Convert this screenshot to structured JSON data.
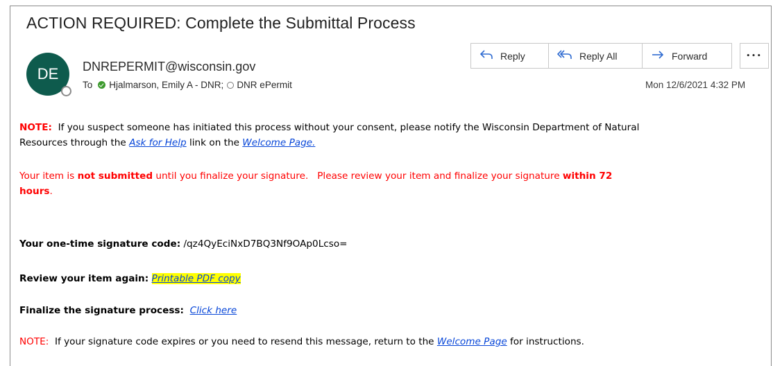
{
  "email": {
    "subject": "ACTION REQUIRED: Complete the Submittal Process",
    "avatar_initials": "DE",
    "sender": "DNREPERMIT@wisconsin.gov",
    "to_label": "To",
    "recipients": [
      "Hjalmarson, Emily A - DNR;",
      "DNR ePermit"
    ],
    "timestamp": "Mon 12/6/2021 4:32 PM"
  },
  "toolbar": {
    "reply_label": "Reply",
    "reply_all_label": "Reply All",
    "forward_label": "Forward",
    "more_label": "•••",
    "reply_icon": "reply-icon",
    "reply_all_icon": "reply-all-icon",
    "forward_icon": "forward-arrow-icon"
  },
  "content": {
    "note1_label": "NOTE:",
    "note1_text_a": "  If you suspect someone has initiated this process without your consent, please notify the Wisconsin Department of Natural",
    "note1_text_b": "Resources through the ",
    "ask_for_help_link": "Ask for Help",
    "note1_text_c": " link on the ",
    "welcome_page_link": "Welcome Page.",
    "warn_a": "Your item is ",
    "warn_not_submitted": "not submitted",
    "warn_b": " until you finalize your signature.   Please review your item and finalize your signature ",
    "warn_within": "within 72",
    "warn_hours": "hours",
    "warn_period": ".",
    "code_label": "Your one-time signature code:",
    "code_value": " /qz4QyEciNxD7BQ3Nf9OAp0Lcso=",
    "review_label": "Review your item again:",
    "review_link": "Printable PDF copy",
    "finalize_label": "Finalize the signature process:",
    "finalize_link": "Click here",
    "note2_label": "NOTE:",
    "note2_text_a": "  If your signature code expires or you need to resend this message, return to the ",
    "note2_welcome_link": "Welcome Page",
    "note2_text_b": " for instructions."
  },
  "colors": {
    "accent_red": "#ff0000",
    "link_blue": "#0645d8",
    "avatar_green": "#0e5b4d",
    "highlight_yellow": "#ffff00"
  }
}
